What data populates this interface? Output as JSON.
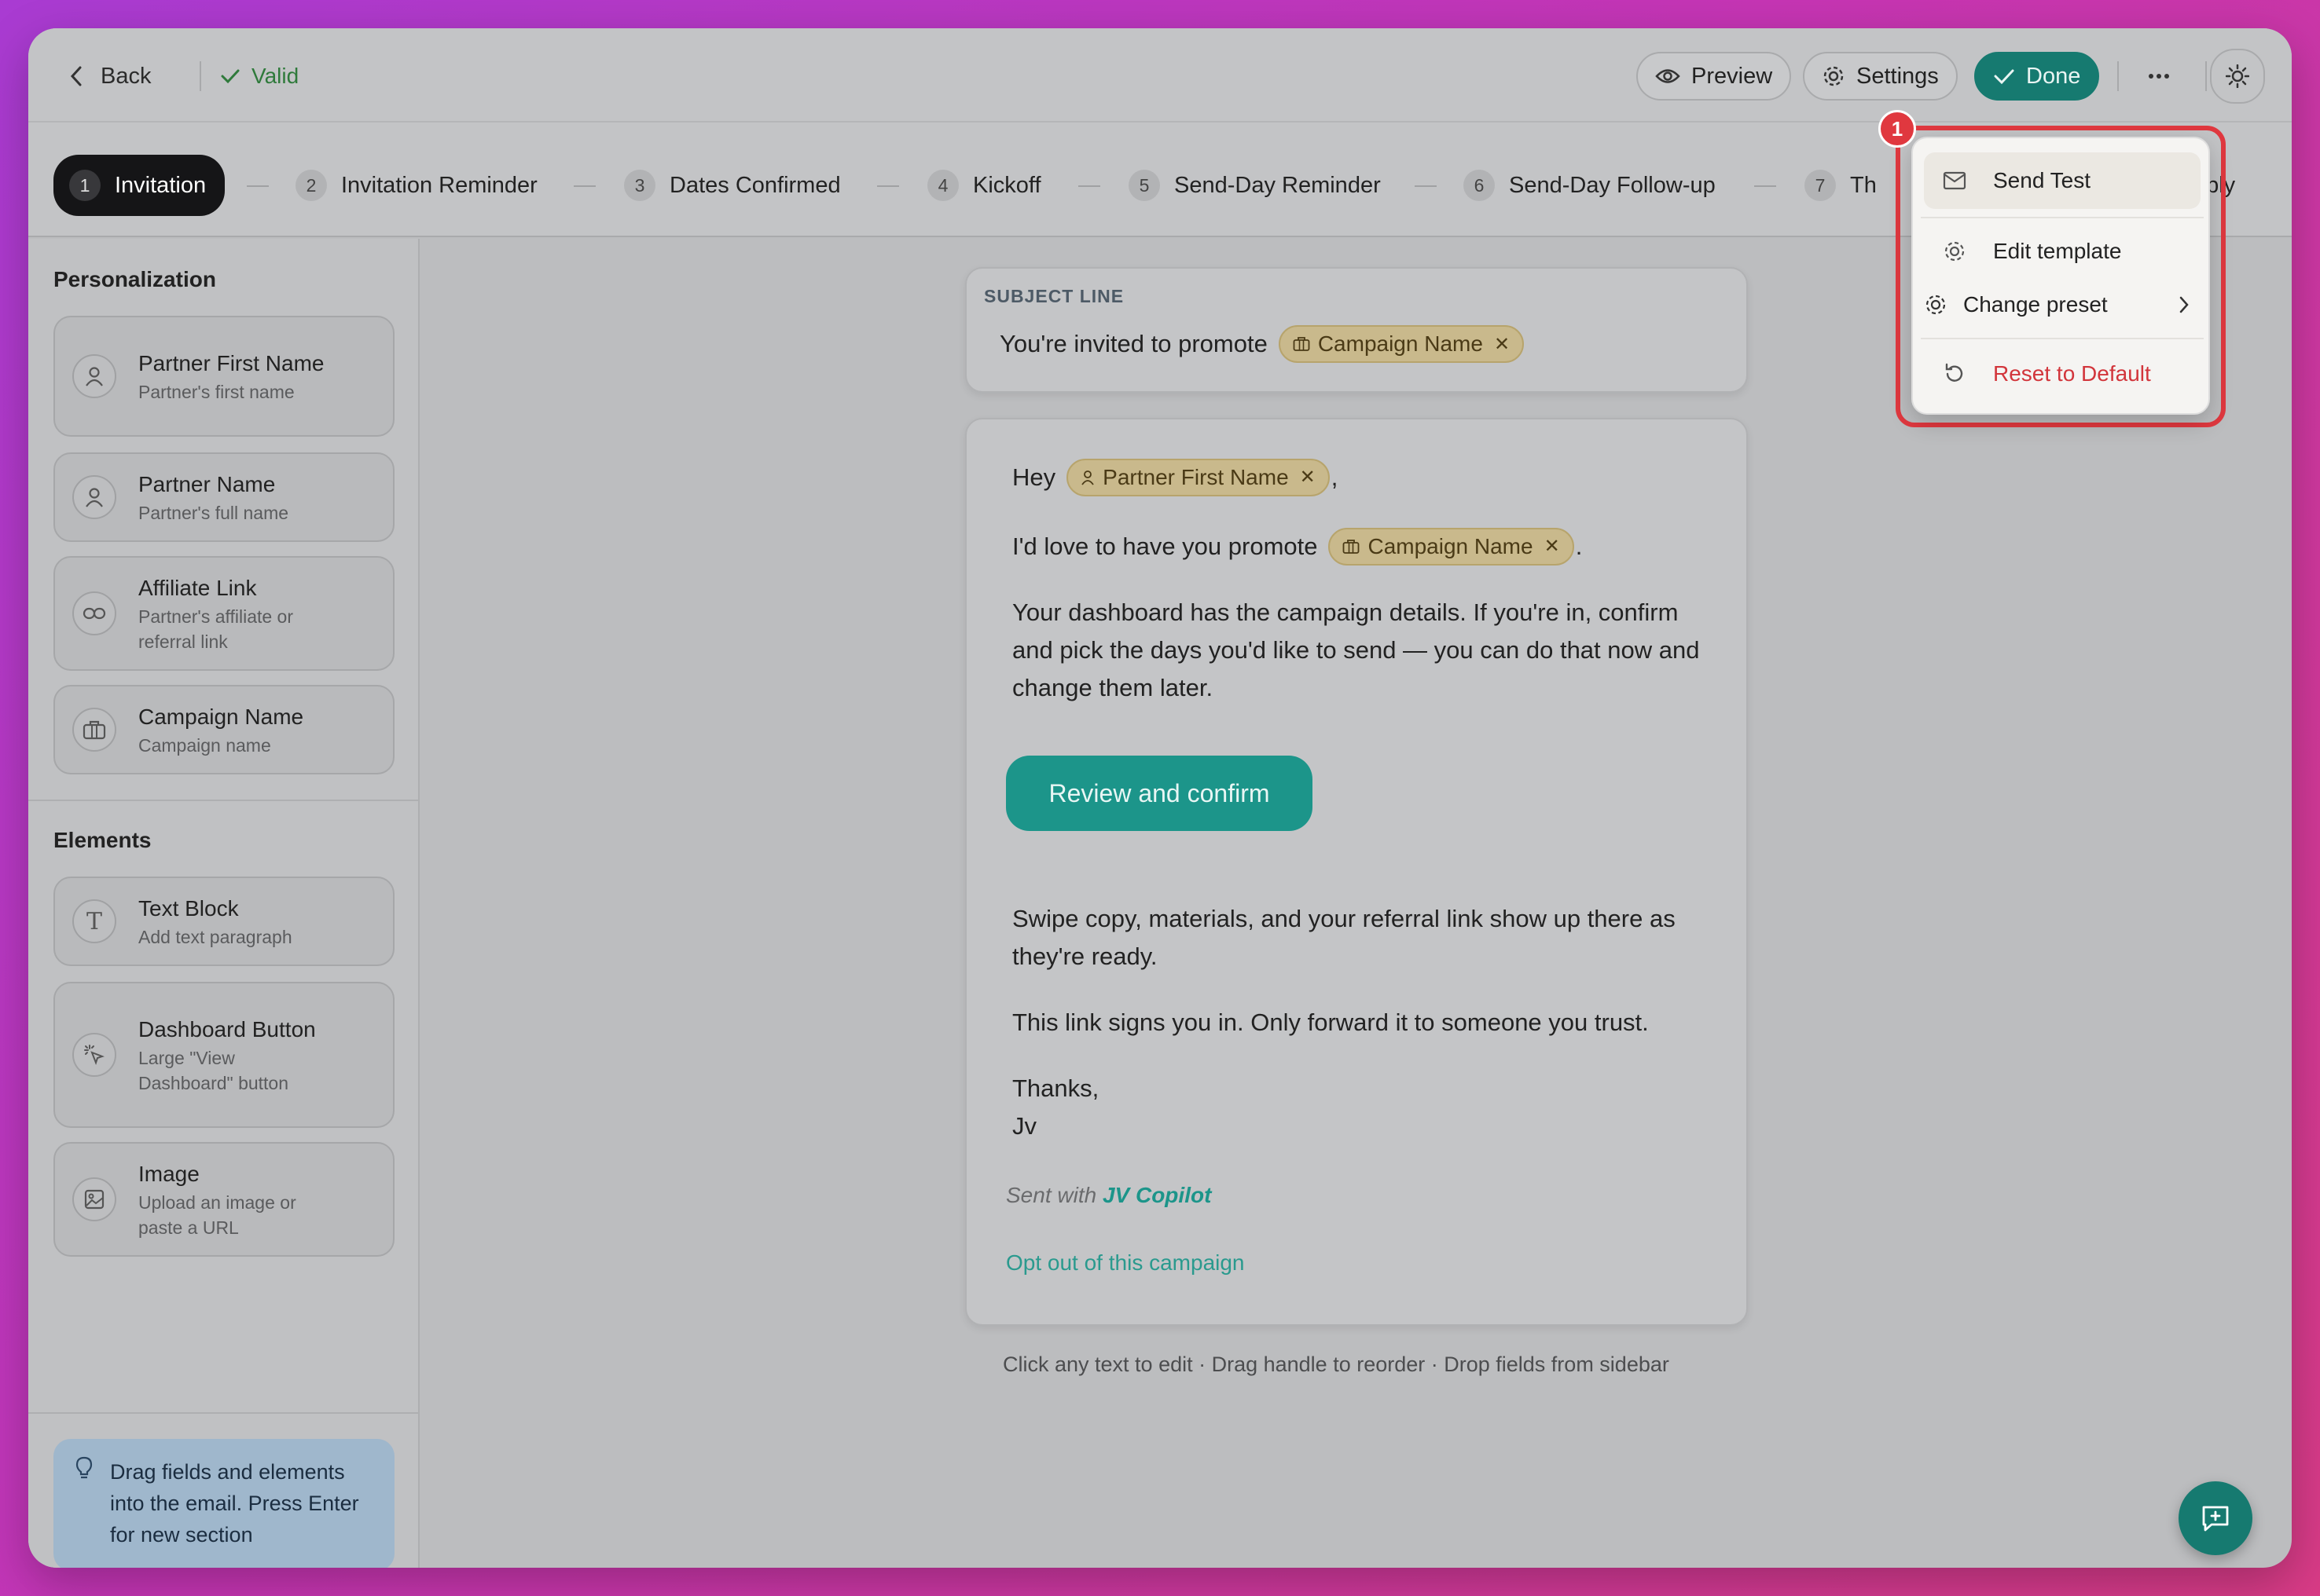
{
  "topbar": {
    "back_label": "Back",
    "valid_label": "Valid",
    "preview_label": "Preview",
    "settings_label": "Settings",
    "done_label": "Done"
  },
  "steps": [
    {
      "num": "1",
      "label": "Invitation"
    },
    {
      "num": "2",
      "label": "Invitation Reminder"
    },
    {
      "num": "3",
      "label": "Dates Confirmed"
    },
    {
      "num": "4",
      "label": "Kickoff"
    },
    {
      "num": "5",
      "label": "Send-Day Reminder"
    },
    {
      "num": "6",
      "label": "Send-Day Follow-up"
    },
    {
      "num": "7",
      "label": "Th"
    },
    {
      "num": "",
      "label": "Reply"
    }
  ],
  "sidebar": {
    "personalization_title": "Personalization",
    "fields": [
      {
        "title": "Partner First Name",
        "subtitle": "Partner's first name",
        "icon": "user-icon"
      },
      {
        "title": "Partner Name",
        "subtitle": "Partner's full name",
        "icon": "user-icon"
      },
      {
        "title": "Affiliate Link",
        "subtitle": "Partner's affiliate or referral link",
        "icon": "link-icon"
      },
      {
        "title": "Campaign Name",
        "subtitle": "Campaign name",
        "icon": "briefcase-icon"
      }
    ],
    "elements_title": "Elements",
    "elements": [
      {
        "title": "Text Block",
        "subtitle": "Add text paragraph",
        "icon": "text-icon"
      },
      {
        "title": "Dashboard Button",
        "subtitle": "Large \"View Dashboard\" button",
        "icon": "pointer-click-icon"
      },
      {
        "title": "Image",
        "subtitle": "Upload an image or paste a URL",
        "icon": "image-icon"
      }
    ],
    "tip": "Drag fields and elements into the email. Press Enter for new section"
  },
  "email": {
    "subject_label": "SUBJECT LINE",
    "subject_text": "You're invited to promote",
    "subject_chip": "Campaign Name",
    "greeting": "Hey",
    "greeting_chip": "Partner First Name",
    "greeting_end": ",",
    "line2_text": "I'd love to have you promote",
    "line2_chip": "Campaign Name",
    "line2_end": ".",
    "para1": "Your dashboard has the campaign details. If you're in, confirm and pick the days you'd like to send — you can do that now and change them later.",
    "cta_label": "Review and confirm",
    "para2": "Swipe copy, materials, and your referral link show up there as they're ready.",
    "para3": "This link signs you in. Only forward it to someone you trust.",
    "signoff": "Thanks,",
    "signature": "Jv",
    "sent_with": "Sent with",
    "sent_brand": "JV Copilot",
    "opt_out": "Opt out of this campaign"
  },
  "hint": "Click any text to edit · Drag handle to reorder · Drop fields from sidebar",
  "menu": {
    "badge": "1",
    "send_test": "Send Test",
    "edit_template": "Edit template",
    "change_preset": "Change preset",
    "reset": "Reset to Default"
  },
  "colors": {
    "accent": "#167a70",
    "danger": "#d2353b",
    "chip": "#c9b98c"
  }
}
